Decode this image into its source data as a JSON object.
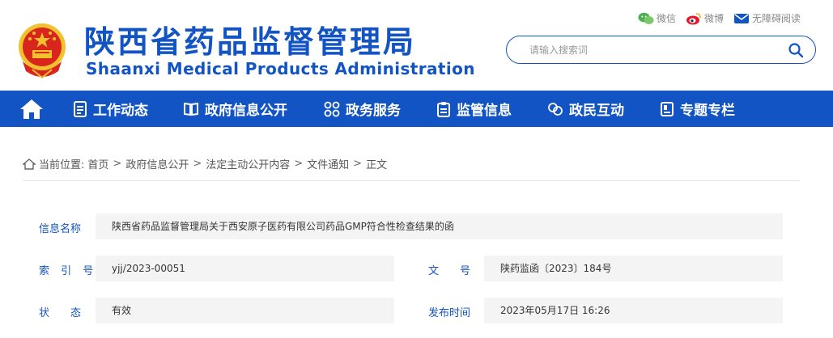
{
  "header": {
    "title_cn": "陕西省药品监督管理局",
    "title_en": "Shaanxi Medical Products Administration",
    "toplinks": {
      "wechat": "微信",
      "weibo": "微博",
      "accessible": "无障碍阅读"
    },
    "search": {
      "placeholder": "请输入搜索词",
      "value": ""
    }
  },
  "nav": {
    "items": [
      {
        "label": "工作动态",
        "icon": "document-list-icon"
      },
      {
        "label": "政府信息公开",
        "icon": "book-icon"
      },
      {
        "label": "政务服务",
        "icon": "grid-icon"
      },
      {
        "label": "监管信息",
        "icon": "clipboard-icon"
      },
      {
        "label": "政民互动",
        "icon": "interaction-icon"
      },
      {
        "label": "专题专栏",
        "icon": "bookmark-icon"
      }
    ]
  },
  "breadcrumb": {
    "prefix": "当前位置:",
    "items": [
      "首页",
      "政府信息公开",
      "法定主动公开内容",
      "文件通知",
      "正文"
    ]
  },
  "info": {
    "name_label": "信息名称",
    "name_value": "陕西省药品监督管理局关于西安原子医药有限公司药品GMP符合性检查结果的函",
    "index_label": "索 引 号",
    "index_value": "yjj/2023-00051",
    "docno_label": "文　　号",
    "docno_value": "陕药监函〔2023〕184号",
    "status_label": "状　　态",
    "status_value": "有效",
    "date_label": "发布时间",
    "date_value": "2023年05月17日 16:26"
  },
  "colors": {
    "brand": "#1254c4",
    "emblem_red": "#d9261c",
    "emblem_gold": "#f2c12e"
  }
}
